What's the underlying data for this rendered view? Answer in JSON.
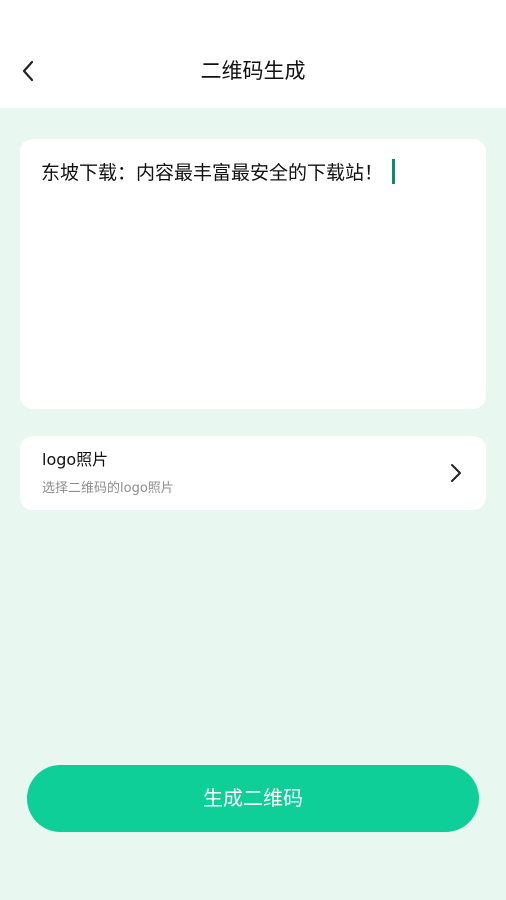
{
  "header": {
    "title": "二维码生成",
    "back_icon": "chevron-left-icon"
  },
  "content_input": {
    "value": "东坡下载：内容最丰富最安全的下载站！"
  },
  "logo_option": {
    "title": "logo照片",
    "subtitle": "选择二维码的logo照片",
    "icon": "chevron-right-icon"
  },
  "generate_button": {
    "label": "生成二维码"
  },
  "colors": {
    "page_background": "#e8f8f0",
    "card_background": "#ffffff",
    "accent": "#0ecf98",
    "caret": "#0b8a6a"
  }
}
